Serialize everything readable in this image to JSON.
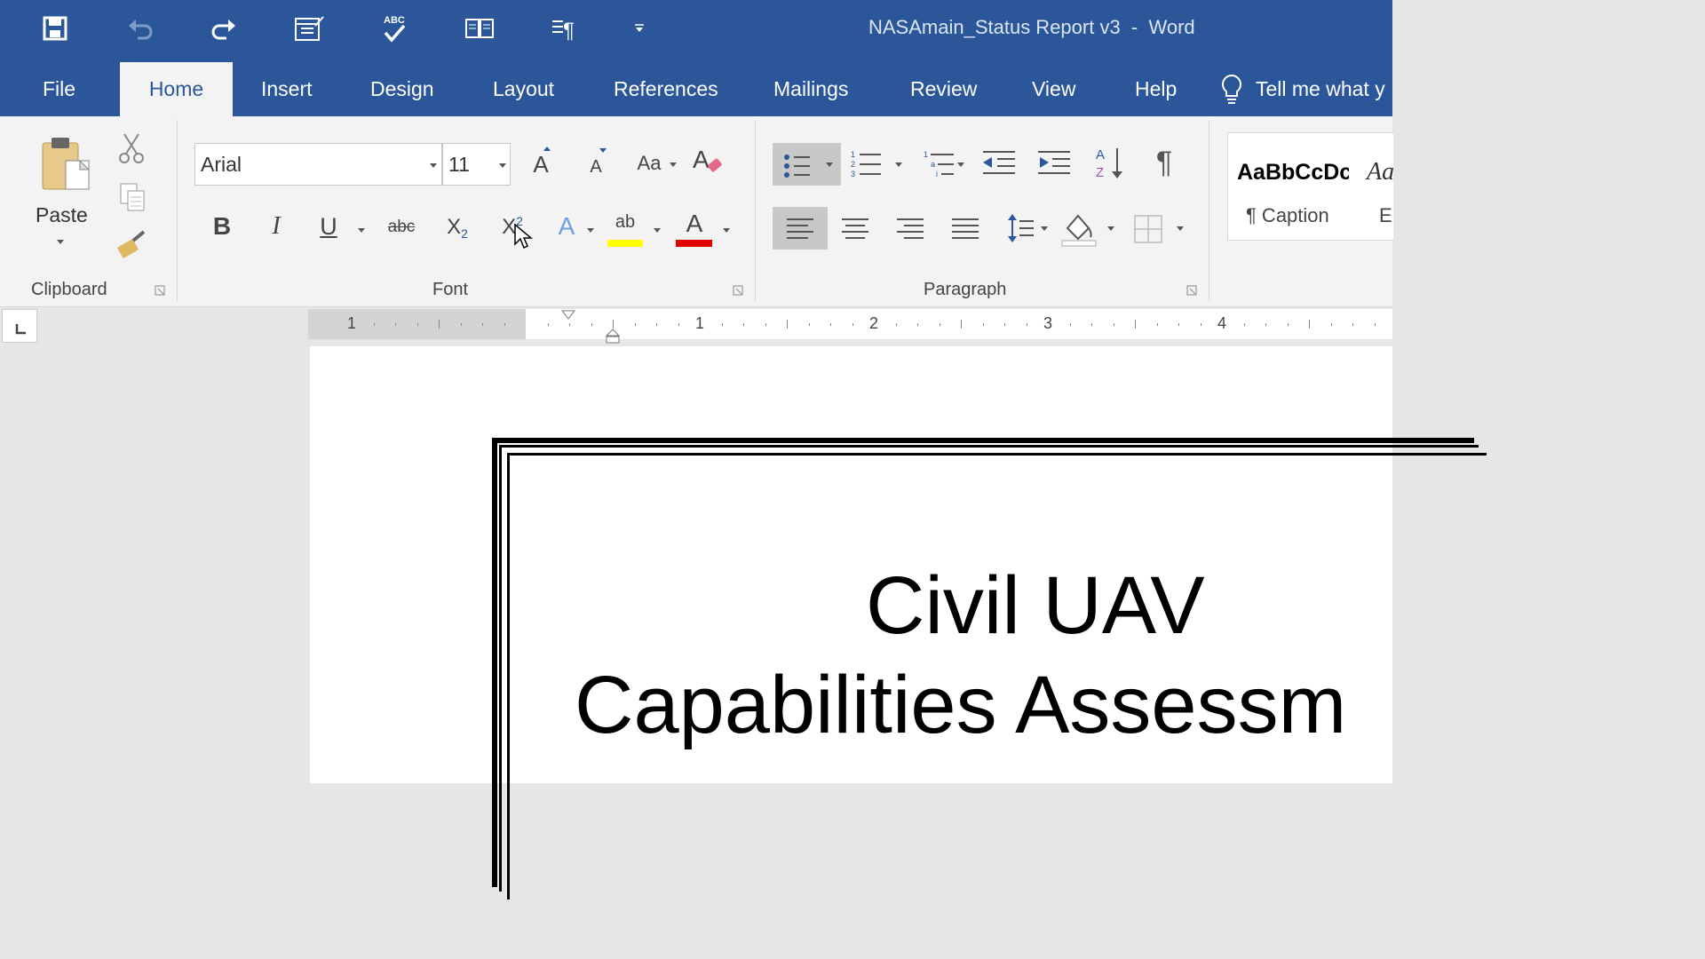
{
  "window": {
    "title": "NASAmain_Status Report v3  -  Word"
  },
  "quick_access": [
    {
      "name": "save-icon"
    },
    {
      "name": "undo-icon"
    },
    {
      "name": "redo-icon"
    },
    {
      "name": "form-icon"
    },
    {
      "name": "spelling-icon"
    },
    {
      "name": "read-mode-icon"
    },
    {
      "name": "show-formatting-icon"
    },
    {
      "name": "customize-icon"
    }
  ],
  "tabs": {
    "file": "File",
    "home": "Home",
    "insert": "Insert",
    "design": "Design",
    "layout": "Layout",
    "references": "References",
    "mailings": "Mailings",
    "review": "Review",
    "view": "View",
    "help": "Help",
    "tell_me": "Tell me what y"
  },
  "clipboard": {
    "paste_label": "Paste",
    "group_label": "Clipboard"
  },
  "font": {
    "family": "Arial",
    "size": "11",
    "group_label": "Font",
    "grow_label": "A",
    "shrink_label": "A",
    "case_label": "Aa",
    "bold": "B",
    "italic": "I",
    "underline": "U",
    "strike": "abc",
    "subscript": "X",
    "subscript_small": "2",
    "superscript": "X",
    "superscript_small": "2",
    "effects_label": "A",
    "highlight_label": "ab",
    "color_label": "A",
    "highlight_color": "#ffff00",
    "font_color": "#e00000"
  },
  "paragraph": {
    "group_label": "Paragraph",
    "pilcrow": "¶"
  },
  "styles": {
    "normal_preview": "AaBbCcDc",
    "caption_label": "¶ Caption",
    "italic_preview": "Aa",
    "emphasis_label": "E"
  },
  "ruler": {
    "numbers": [
      "1",
      "1",
      "2",
      "3",
      "4"
    ]
  },
  "document": {
    "title_line1": "Civil UAV",
    "title_line2": "Capabilities Assessm"
  },
  "colors": {
    "accent": "#2b579a",
    "ribbon": "#f3f3f3"
  }
}
